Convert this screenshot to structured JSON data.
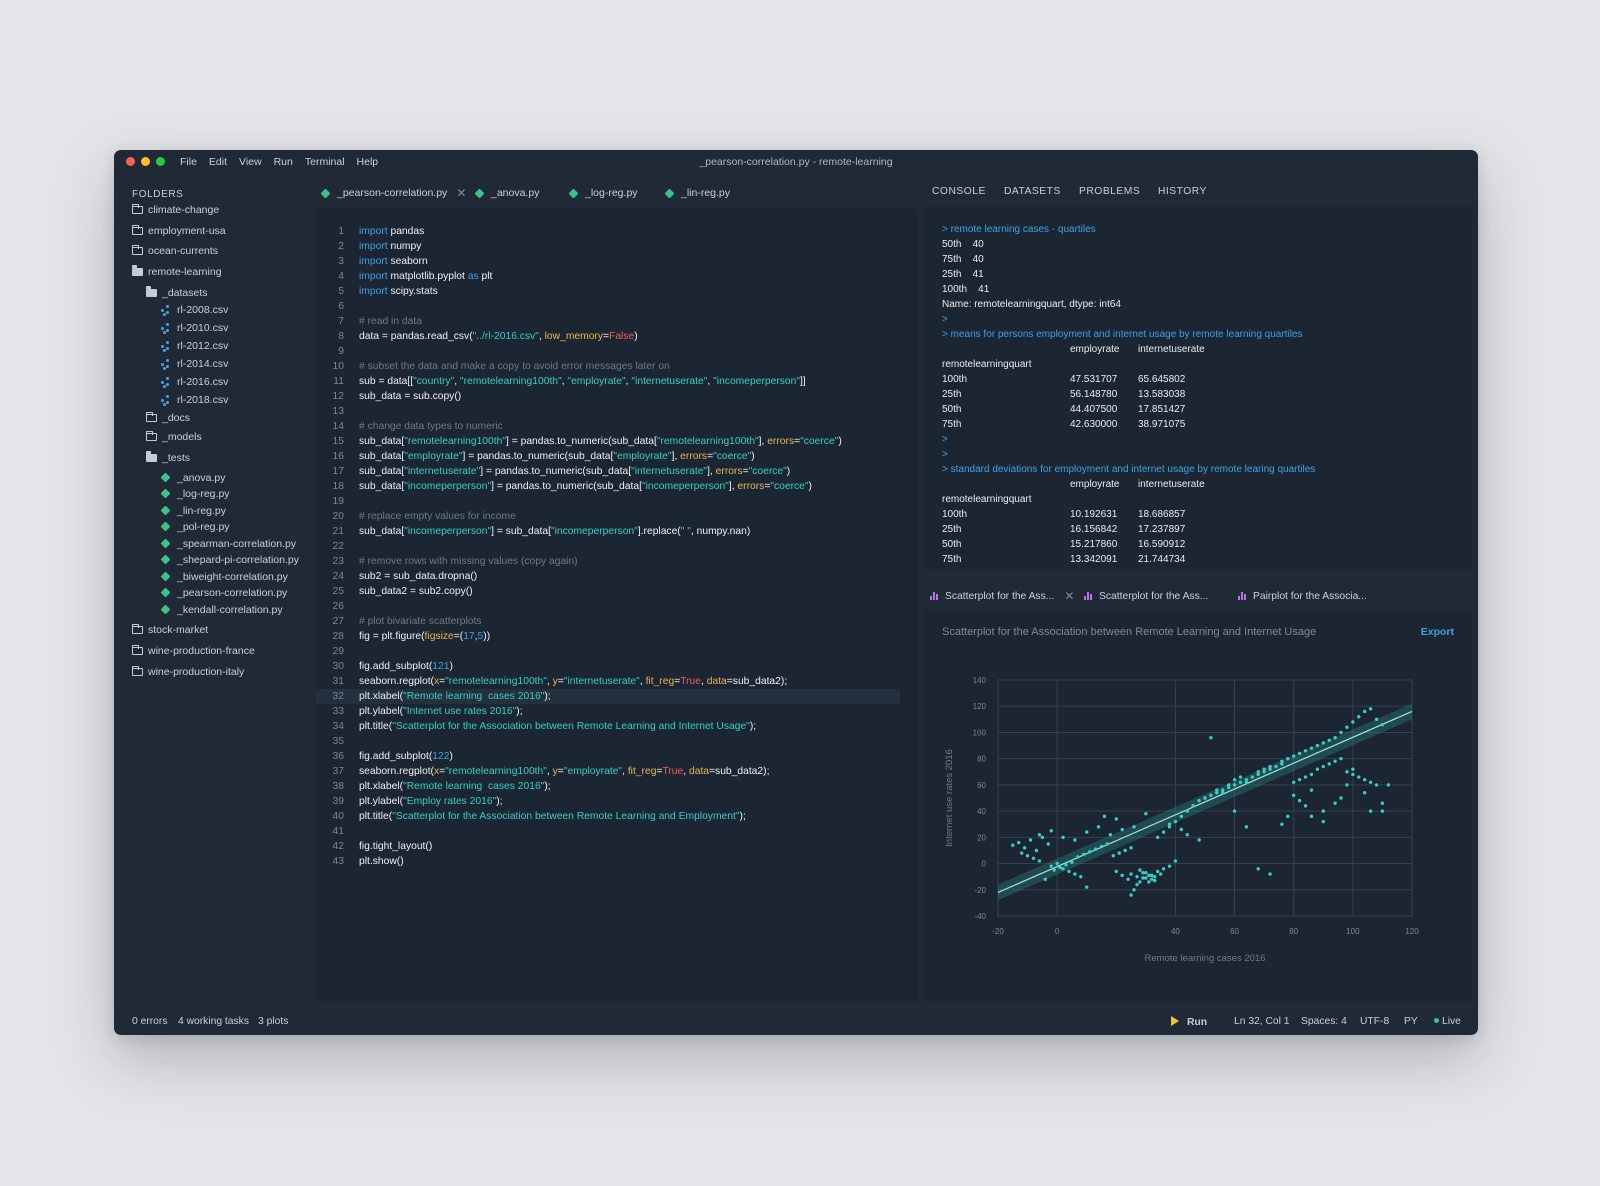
{
  "window": {
    "title": "_pearson-correlation.py - remote-learning",
    "menu": [
      "File",
      "Edit",
      "View",
      "Run",
      "Terminal",
      "Help"
    ]
  },
  "sidebar": {
    "header": "FOLDERS",
    "items": [
      {
        "label": "climate-change",
        "kind": "folder"
      },
      {
        "label": "employment-usa",
        "kind": "folder"
      },
      {
        "label": "ocean-currents",
        "kind": "folder"
      },
      {
        "label": "remote-learning",
        "kind": "folder-open"
      },
      {
        "label": "_datasets",
        "kind": "folder-open"
      },
      {
        "label": "rl-2008.csv",
        "kind": "csv"
      },
      {
        "label": "rl-2010.csv",
        "kind": "csv"
      },
      {
        "label": "rl-2012.csv",
        "kind": "csv"
      },
      {
        "label": "rl-2014.csv",
        "kind": "csv"
      },
      {
        "label": "rl-2016.csv",
        "kind": "csv"
      },
      {
        "label": "rl-2018.csv",
        "kind": "csv"
      },
      {
        "label": "_docs",
        "kind": "folder"
      },
      {
        "label": "_models",
        "kind": "folder"
      },
      {
        "label": "_tests",
        "kind": "folder-open"
      },
      {
        "label": "_anova.py",
        "kind": "py"
      },
      {
        "label": "_log-reg.py",
        "kind": "py"
      },
      {
        "label": "_lin-reg.py",
        "kind": "py"
      },
      {
        "label": "_pol-reg.py",
        "kind": "py"
      },
      {
        "label": "_spearman-correlation.py",
        "kind": "py"
      },
      {
        "label": "_shepard-pi-correlation.py",
        "kind": "py"
      },
      {
        "label": "_biweight-correlation.py",
        "kind": "py"
      },
      {
        "label": "_pearson-correlation.py",
        "kind": "py"
      },
      {
        "label": "_kendall-correlation.py",
        "kind": "py"
      },
      {
        "label": "stock-market",
        "kind": "folder"
      },
      {
        "label": "wine-production-france",
        "kind": "folder"
      },
      {
        "label": "wine-production-italy",
        "kind": "folder"
      }
    ]
  },
  "editor": {
    "tabs": [
      "_pearson-correlation.py",
      "_anova.py",
      "_log-reg.py",
      "_lin-reg.py"
    ],
    "active_tab": 0,
    "highlight_line": 32,
    "lines": [
      [
        [
          "k",
          "import"
        ],
        [
          "t",
          " pandas"
        ]
      ],
      [
        [
          "k",
          "import"
        ],
        [
          "t",
          " numpy"
        ]
      ],
      [
        [
          "k",
          "import"
        ],
        [
          "t",
          " seaborn"
        ]
      ],
      [
        [
          "k",
          "import"
        ],
        [
          "t",
          " matplotlib.pyplot "
        ],
        [
          "k",
          "as"
        ],
        [
          "t",
          " plt"
        ]
      ],
      [
        [
          "k",
          "import"
        ],
        [
          "t",
          " scipy.stats"
        ]
      ],
      [],
      [
        [
          "c",
          "# read in data"
        ]
      ],
      [
        [
          "t",
          "data = pandas.read_csv("
        ],
        [
          "s",
          "\"../rl-2016.csv\""
        ],
        [
          "t",
          ", "
        ],
        [
          "o",
          "low_memory"
        ],
        [
          "t",
          "="
        ],
        [
          "f",
          "False"
        ],
        [
          "t",
          ")"
        ]
      ],
      [],
      [
        [
          "c",
          "# subset the data and make a copy to avoid error messages later on"
        ]
      ],
      [
        [
          "t",
          "sub = data[["
        ],
        [
          "s",
          "\"country\""
        ],
        [
          "t",
          ", "
        ],
        [
          "s",
          "\"remotelearning100th\""
        ],
        [
          "t",
          ", "
        ],
        [
          "s",
          "\"employrate\""
        ],
        [
          "t",
          ", "
        ],
        [
          "s",
          "\"internetuserate\""
        ],
        [
          "t",
          ", "
        ],
        [
          "s",
          "\"incomeperperson\""
        ],
        [
          "t",
          "]]"
        ]
      ],
      [
        [
          "t",
          "sub_data = sub.copy()"
        ]
      ],
      [],
      [
        [
          "c",
          "# change data types to numeric"
        ]
      ],
      [
        [
          "t",
          "sub_data["
        ],
        [
          "s",
          "\"remotelearning100th\""
        ],
        [
          "t",
          "] = pandas.to_numeric(sub_data["
        ],
        [
          "s",
          "\"remotelearning100th\""
        ],
        [
          "t",
          "], "
        ],
        [
          "o",
          "errors"
        ],
        [
          "t",
          "="
        ],
        [
          "s",
          "\"coerce\""
        ],
        [
          "t",
          ")"
        ]
      ],
      [
        [
          "t",
          "sub_data["
        ],
        [
          "s",
          "\"employrate\""
        ],
        [
          "t",
          "] = pandas.to_numeric(sub_data["
        ],
        [
          "s",
          "\"employrate\""
        ],
        [
          "t",
          "], "
        ],
        [
          "o",
          "errors"
        ],
        [
          "t",
          "="
        ],
        [
          "s",
          "\"coerce\""
        ],
        [
          "t",
          ")"
        ]
      ],
      [
        [
          "t",
          "sub_data["
        ],
        [
          "s",
          "\"internetuserate\""
        ],
        [
          "t",
          "] = pandas.to_numeric(sub_data["
        ],
        [
          "s",
          "\"internetuserate\""
        ],
        [
          "t",
          "], "
        ],
        [
          "o",
          "errors"
        ],
        [
          "t",
          "="
        ],
        [
          "s",
          "\"coerce\""
        ],
        [
          "t",
          ")"
        ]
      ],
      [
        [
          "t",
          "sub_data["
        ],
        [
          "s",
          "\"incomeperperson\""
        ],
        [
          "t",
          "] = pandas.to_numeric(sub_data["
        ],
        [
          "s",
          "\"incomeperperson\""
        ],
        [
          "t",
          "], "
        ],
        [
          "o",
          "errors"
        ],
        [
          "t",
          "="
        ],
        [
          "s",
          "\"coerce\""
        ],
        [
          "t",
          ")"
        ]
      ],
      [],
      [
        [
          "c",
          "# replace empty values for income"
        ]
      ],
      [
        [
          "t",
          "sub_data["
        ],
        [
          "s",
          "\"incomeperperson\""
        ],
        [
          "t",
          "] = sub_data["
        ],
        [
          "s",
          "\"incomeperperson\""
        ],
        [
          "t",
          "].replace("
        ],
        [
          "s",
          "\" \""
        ],
        [
          "t",
          ", numpy.nan)"
        ]
      ],
      [],
      [
        [
          "c",
          "# remove rows with missing values (copy again)"
        ]
      ],
      [
        [
          "t",
          "sub2 = sub_data.dropna()"
        ]
      ],
      [
        [
          "t",
          "sub_data2 = sub2.copy()"
        ]
      ],
      [],
      [
        [
          "c",
          "# plot bivariate scatterplots"
        ]
      ],
      [
        [
          "t",
          "fig = plt.figure("
        ],
        [
          "o",
          "figsize"
        ],
        [
          "t",
          "=("
        ],
        [
          "n",
          "17"
        ],
        [
          "t",
          ","
        ],
        [
          "n",
          "5"
        ],
        [
          "t",
          "))"
        ]
      ],
      [],
      [
        [
          "t",
          "fig.add_subplot("
        ],
        [
          "n",
          "121"
        ],
        [
          "t",
          ")"
        ]
      ],
      [
        [
          "t",
          "seaborn.regplot("
        ],
        [
          "o",
          "x"
        ],
        [
          "t",
          "="
        ],
        [
          "s",
          "\"remotelearning100th\""
        ],
        [
          "t",
          ", "
        ],
        [
          "o",
          "y"
        ],
        [
          "t",
          "="
        ],
        [
          "s",
          "\"internetuserate\""
        ],
        [
          "t",
          ", "
        ],
        [
          "o",
          "fit_reg"
        ],
        [
          "t",
          "="
        ],
        [
          "f",
          "True"
        ],
        [
          "t",
          ", "
        ],
        [
          "o",
          "data"
        ],
        [
          "t",
          "=sub_data2);"
        ]
      ],
      [
        [
          "t",
          "plt.xlabel("
        ],
        [
          "s",
          "\"Remote learning  cases 2016\""
        ],
        [
          "t",
          ");"
        ]
      ],
      [
        [
          "t",
          "plt.ylabel("
        ],
        [
          "s",
          "\"Internet use rates 2016\""
        ],
        [
          "t",
          ");"
        ]
      ],
      [
        [
          "t",
          "plt.title("
        ],
        [
          "s",
          "\"Scatterplot for the Association between Remote Learning and Internet Usage\""
        ],
        [
          "t",
          ");"
        ]
      ],
      [],
      [
        [
          "t",
          "fig.add_subplot("
        ],
        [
          "n",
          "122"
        ],
        [
          "t",
          ")"
        ]
      ],
      [
        [
          "t",
          "seaborn.regplot("
        ],
        [
          "o",
          "x"
        ],
        [
          "t",
          "="
        ],
        [
          "s",
          "\"remotelearning100th\""
        ],
        [
          "t",
          ", "
        ],
        [
          "o",
          "y"
        ],
        [
          "t",
          "="
        ],
        [
          "s",
          "\"employrate\""
        ],
        [
          "t",
          ", "
        ],
        [
          "o",
          "fit_reg"
        ],
        [
          "t",
          "="
        ],
        [
          "f",
          "True"
        ],
        [
          "t",
          ", "
        ],
        [
          "o",
          "data"
        ],
        [
          "t",
          "=sub_data2);"
        ]
      ],
      [
        [
          "t",
          "plt.xlabel("
        ],
        [
          "s",
          "\"Remote learning  cases 2016\""
        ],
        [
          "t",
          ");"
        ]
      ],
      [
        [
          "t",
          "plt.ylabel("
        ],
        [
          "s",
          "\"Employ rates 2016\""
        ],
        [
          "t",
          ");"
        ]
      ],
      [
        [
          "t",
          "plt.title("
        ],
        [
          "s",
          "\"Scatterplot for the Association between Remote Learning and Employment\""
        ],
        [
          "t",
          ");"
        ]
      ],
      [],
      [
        [
          "t",
          "fig.tight_layout()"
        ]
      ],
      [
        [
          "t",
          "plt.show()"
        ]
      ]
    ]
  },
  "console": {
    "tabs": [
      "CONSOLE",
      "DATASETS",
      "PROBLEMS",
      "HISTORY"
    ],
    "lines": [
      {
        "type": "prompt",
        "text": "> remote learning cases - quartiles"
      },
      {
        "type": "out",
        "cols": [
          "50th    40"
        ]
      },
      {
        "type": "out",
        "cols": [
          "75th    40"
        ]
      },
      {
        "type": "out",
        "cols": [
          "25th    41"
        ]
      },
      {
        "type": "out",
        "cols": [
          "100th    41"
        ]
      },
      {
        "type": "out",
        "cols": [
          "Name: remotelearningquart, dtype: int64"
        ]
      },
      {
        "type": "prompt",
        "text": ">"
      },
      {
        "type": "prompt",
        "text": "> means for persons employment and internet usage by remote learning quartiles"
      },
      {
        "type": "out",
        "cols": [
          "",
          "employrate",
          "internetuserate"
        ]
      },
      {
        "type": "out",
        "cols": [
          "remotelearningquart"
        ]
      },
      {
        "type": "out",
        "cols": [
          "100th",
          "47.531707",
          "65.645802"
        ]
      },
      {
        "type": "out",
        "cols": [
          "25th",
          "56.148780",
          "13.583038"
        ]
      },
      {
        "type": "out",
        "cols": [
          "50th",
          "44.407500",
          "17.851427"
        ]
      },
      {
        "type": "out",
        "cols": [
          "75th",
          "42.630000",
          "38.971075"
        ]
      },
      {
        "type": "prompt",
        "text": ">"
      },
      {
        "type": "prompt",
        "text": ">"
      },
      {
        "type": "prompt",
        "text": "> standard deviations for employment and internet usage by remote learing quartiles"
      },
      {
        "type": "out",
        "cols": [
          "",
          "employrate",
          "internetuserate"
        ]
      },
      {
        "type": "out",
        "cols": [
          "remotelearningquart"
        ]
      },
      {
        "type": "out",
        "cols": [
          "100th",
          "10.192631",
          "18.686857"
        ]
      },
      {
        "type": "out",
        "cols": [
          "25th",
          "16.156842",
          "17.237897"
        ]
      },
      {
        "type": "out",
        "cols": [
          "50th",
          "15.217860",
          "16.590912"
        ]
      },
      {
        "type": "out",
        "cols": [
          "75th",
          "13.342091",
          "21.744734"
        ]
      }
    ]
  },
  "plots": {
    "tabs": [
      "Scatterplot for the Ass...",
      "Scatterplot for the Ass...",
      "Pairplot for the Associa..."
    ],
    "title": "Scatterplot for the Association between Remote Learning and Internet Usage",
    "export_label": "Export"
  },
  "chart_data": {
    "type": "scatter",
    "title": "",
    "xlabel": "Remote learning cases 2016",
    "ylabel": "Internet use rates 2016",
    "xlim": [
      -20,
      120
    ],
    "ylim": [
      -40,
      140
    ],
    "xticks": [
      -20,
      0,
      40,
      60,
      80,
      100,
      120
    ],
    "yticks": [
      140,
      120,
      100,
      80,
      60,
      40,
      20,
      0,
      -20,
      -40
    ],
    "grid": true,
    "regression": {
      "x": [
        -20,
        120
      ],
      "y": [
        -22,
        116
      ],
      "band": 6
    },
    "point_color": "#35d0c5",
    "x": [
      -15,
      -13,
      -11,
      -9,
      -7,
      -5,
      -3,
      -12,
      -10,
      -8,
      -6,
      -2,
      0,
      2,
      4,
      6,
      8,
      -4,
      -1,
      1,
      3,
      5,
      7,
      9,
      11,
      13,
      15,
      17,
      -6,
      -2,
      2,
      6,
      10,
      14,
      18,
      22,
      26,
      20,
      22,
      24,
      25,
      27,
      28,
      29,
      30,
      31,
      32,
      33,
      34,
      35,
      33,
      32,
      31,
      30,
      29,
      28,
      27,
      26,
      25,
      36,
      38,
      40,
      19,
      21,
      23,
      25,
      34,
      36,
      38,
      40,
      42,
      44,
      46,
      48,
      50,
      52,
      54,
      56,
      58,
      60,
      62,
      64,
      66,
      68,
      70,
      72,
      74,
      76,
      46,
      50,
      54,
      58,
      60,
      62,
      64,
      68,
      70,
      72,
      76,
      78,
      80,
      82,
      84,
      86,
      88,
      90,
      92,
      94,
      96,
      98,
      100,
      102,
      104,
      106,
      108,
      110,
      112,
      80,
      82,
      84,
      86,
      88,
      90,
      92,
      94,
      96,
      98,
      100,
      102,
      104,
      106,
      108,
      110,
      78,
      80,
      82,
      84,
      86,
      76,
      90,
      94,
      96,
      98,
      100,
      104,
      106,
      16,
      20,
      30,
      38,
      42,
      44,
      48,
      52,
      56,
      110,
      90,
      86,
      60,
      64,
      68,
      72,
      10,
      12,
      8
    ],
    "y": [
      14,
      16,
      12,
      18,
      10,
      20,
      15,
      8,
      6,
      4,
      2,
      -2,
      0,
      -4,
      -6,
      -8,
      -10,
      -12,
      -5,
      -3,
      -1,
      1,
      5,
      7,
      9,
      11,
      13,
      15,
      22,
      25,
      20,
      18,
      24,
      28,
      22,
      26,
      28,
      -6,
      -9,
      -12,
      -8,
      -10,
      -5,
      -7,
      -11,
      -14,
      -9,
      -13,
      -6,
      -8,
      -10,
      -12,
      -9,
      -7,
      -11,
      -14,
      -16,
      -20,
      -24,
      -4,
      -2,
      2,
      6,
      8,
      10,
      12,
      20,
      24,
      28,
      32,
      36,
      40,
      44,
      48,
      50,
      52,
      54,
      56,
      58,
      60,
      62,
      64,
      66,
      68,
      70,
      72,
      74,
      76,
      44,
      50,
      56,
      60,
      64,
      66,
      62,
      70,
      72,
      74,
      78,
      80,
      82,
      84,
      86,
      88,
      90,
      92,
      94,
      96,
      100,
      104,
      108,
      112,
      116,
      118,
      110,
      106,
      60,
      62,
      64,
      66,
      68,
      72,
      74,
      76,
      78,
      80,
      70,
      68,
      66,
      64,
      62,
      60,
      40,
      36,
      52,
      48,
      44,
      56,
      30,
      40,
      46,
      50,
      60,
      72,
      54,
      40,
      36,
      34,
      38,
      30,
      26,
      22,
      18,
      96,
      54,
      46,
      32,
      36,
      40,
      28,
      -4,
      -8,
      -18
    ]
  },
  "status": {
    "errors": "0 errors",
    "tasks": "4 working tasks",
    "plots": "3 plots",
    "run": "Run",
    "position": "Ln 32, Col 1",
    "spaces": "Spaces: 4",
    "encoding": "UTF-8",
    "language": "PY",
    "live": "Live"
  }
}
